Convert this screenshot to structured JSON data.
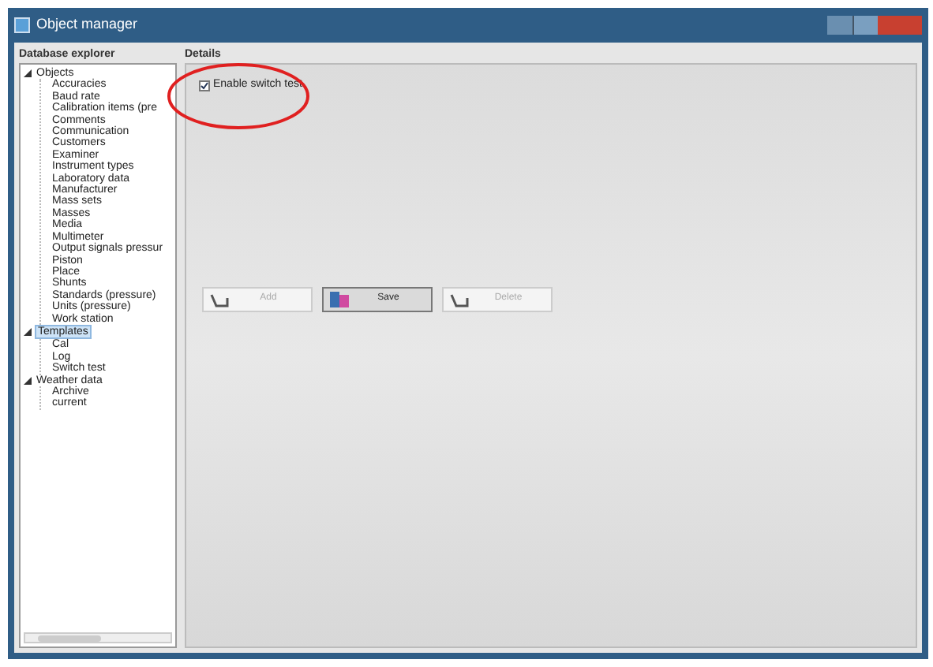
{
  "window": {
    "title": "Object manager"
  },
  "explorer": {
    "title": "Database explorer",
    "tree": [
      {
        "label": "Objects",
        "expanded": true,
        "selected": false,
        "children": [
          {
            "label": "Accuracies",
            "selected": false
          },
          {
            "label": "Baud rate",
            "selected": false
          },
          {
            "label": "Calibration items (pre",
            "selected": false
          },
          {
            "label": "Comments",
            "selected": false
          },
          {
            "label": "Communication",
            "selected": false
          },
          {
            "label": "Customers",
            "selected": false
          },
          {
            "label": "Examiner",
            "selected": false
          },
          {
            "label": "Instrument types",
            "selected": false
          },
          {
            "label": "Laboratory data",
            "selected": false
          },
          {
            "label": "Manufacturer",
            "selected": false
          },
          {
            "label": "Mass sets",
            "selected": false
          },
          {
            "label": "Masses",
            "selected": false
          },
          {
            "label": "Media",
            "selected": false
          },
          {
            "label": "Multimeter",
            "selected": false
          },
          {
            "label": "Output signals pressur",
            "selected": false
          },
          {
            "label": "Piston",
            "selected": false
          },
          {
            "label": "Place",
            "selected": false
          },
          {
            "label": "Shunts",
            "selected": false
          },
          {
            "label": "Standards (pressure)",
            "selected": false
          },
          {
            "label": "Units (pressure)",
            "selected": false
          },
          {
            "label": "Work station",
            "selected": false
          }
        ]
      },
      {
        "label": "Templates",
        "expanded": true,
        "selected": true,
        "children": [
          {
            "label": "Cal",
            "selected": false
          },
          {
            "label": "Log",
            "selected": false
          },
          {
            "label": "Switch test",
            "selected": false
          }
        ]
      },
      {
        "label": "Weather data",
        "expanded": true,
        "selected": false,
        "children": [
          {
            "label": "Archive",
            "selected": false
          },
          {
            "label": "current",
            "selected": false
          }
        ]
      }
    ]
  },
  "details": {
    "title": "Details",
    "checkbox": {
      "label": "Enable switch test",
      "checked": true
    },
    "buttons": [
      {
        "label": "Add",
        "disabled": true
      },
      {
        "label": "Save",
        "disabled": false
      },
      {
        "label": "Delete",
        "disabled": true
      }
    ]
  }
}
